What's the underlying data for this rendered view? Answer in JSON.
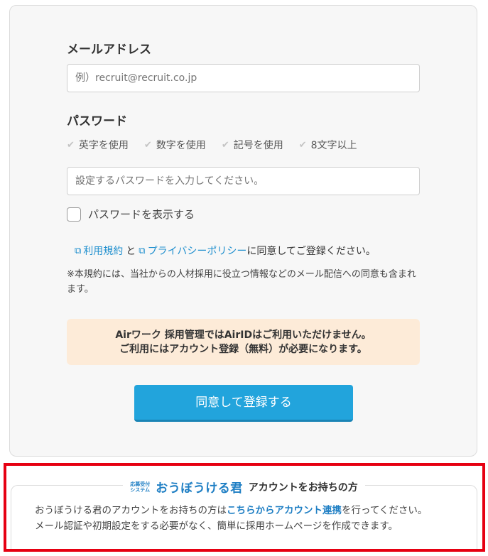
{
  "email": {
    "label": "メールアドレス",
    "placeholder": "例）recruit@recruit.co.jp",
    "value": ""
  },
  "password": {
    "label": "パスワード",
    "rules": [
      "英字を使用",
      "数字を使用",
      "記号を使用",
      "8文字以上"
    ],
    "placeholder": "設定するパスワードを入力してください。",
    "value": "",
    "show_label": "パスワードを表示する",
    "show_checked": false
  },
  "agreement": {
    "terms_link": "利用規約",
    "joiner": "と",
    "privacy_link": "プライバシーポリシー",
    "suffix": "に同意してご登録ください。",
    "note": "※本規約には、当社からの人材採用に役立つ情報などのメール配信への同意も含まれます。"
  },
  "notice": {
    "line1": "Airワーク 採用管理ではAirIDはご利用いただけません。",
    "line2": "ご利用にはアカウント登録（無料）が必要になります。"
  },
  "submit_label": "同意して登録する",
  "oubo": {
    "logo_small_1": "応募受付",
    "logo_small_2": "システム",
    "logo_main": "おうぼうける君",
    "title": "アカウントをお持ちの方",
    "body_pre": "おうぼうける君のアカウントをお持ちの方は",
    "body_link": "こちらからアカウント連携",
    "body_post": "を行ってください。",
    "body_line2": "メール認証や初期設定をする必要がなく、簡単に採用ホームページを作成できます。"
  },
  "colors": {
    "accent": "#22a4dc",
    "link": "#1f8fce",
    "notice_bg": "#fdebd8",
    "highlight_frame": "#e60012"
  }
}
